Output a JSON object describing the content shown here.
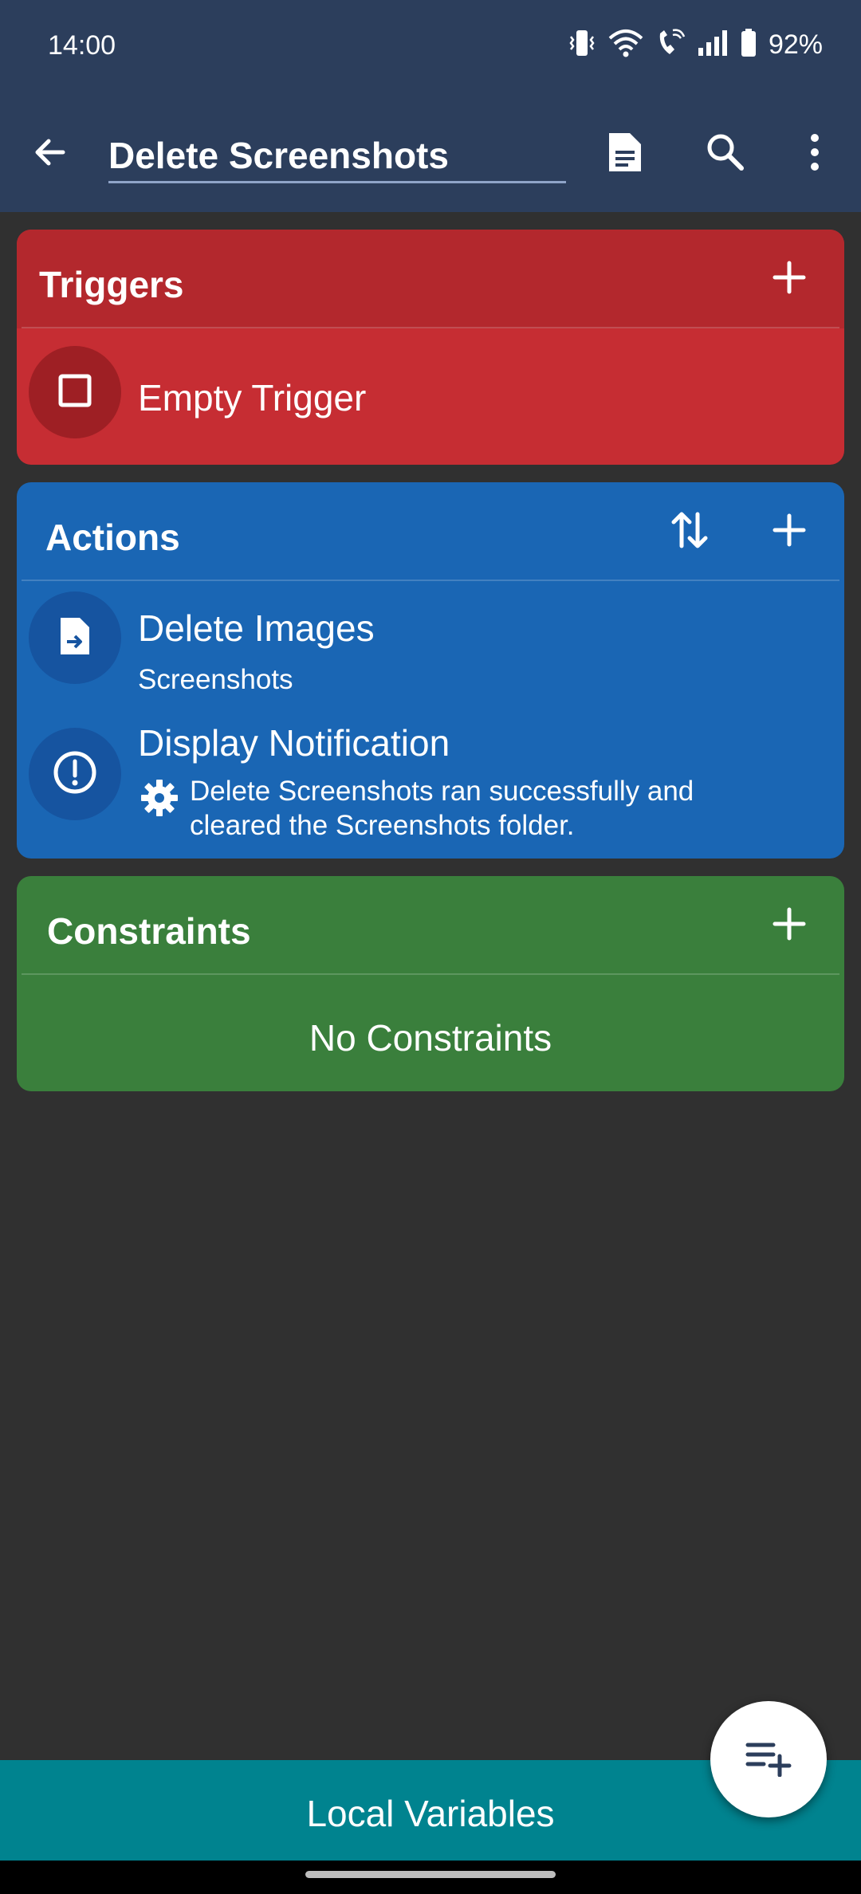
{
  "status_bar": {
    "time": "14:00",
    "battery": "92%",
    "icons": [
      "vibrate-icon",
      "wifi-icon",
      "wifi-calling-icon",
      "signal-icon",
      "battery-icon"
    ]
  },
  "app_bar": {
    "title": "Delete Screenshots",
    "icons": [
      "back-arrow-icon",
      "document-icon",
      "search-icon",
      "more-vert-icon"
    ]
  },
  "triggers": {
    "header": "Triggers",
    "color": "#c62d33",
    "items": [
      {
        "title": "Empty Trigger",
        "icon": "empty-square-icon"
      }
    ]
  },
  "actions": {
    "header": "Actions",
    "color": "#1a66b4",
    "items": [
      {
        "title": "Delete Images",
        "subtitle": "Screenshots",
        "icon": "file-move-icon"
      },
      {
        "title": "Display Notification",
        "subtitle": "Delete Screenshots ran successfully and cleared the Screenshots folder.",
        "icon": "alert-circle-icon",
        "subtitle_icon": "gear-icon"
      }
    ]
  },
  "constraints": {
    "header": "Constraints",
    "color": "#3a7f3c",
    "empty_text": "No Constraints"
  },
  "bottom_bar": {
    "label": "Local Variables",
    "color": "#00838f"
  },
  "fab": {
    "icon": "playlist-add-icon"
  }
}
